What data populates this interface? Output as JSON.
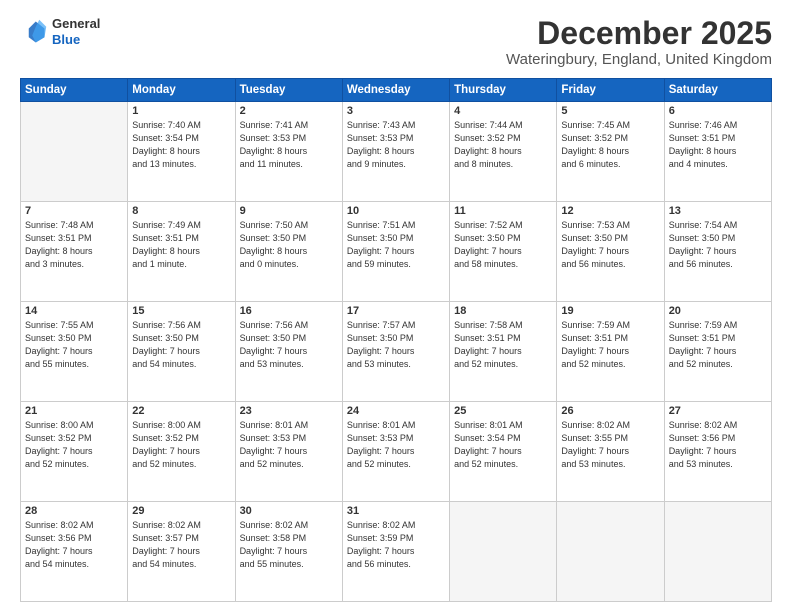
{
  "header": {
    "logo_line1": "General",
    "logo_line2": "Blue",
    "title": "December 2025",
    "subtitle": "Wateringbury, England, United Kingdom"
  },
  "days_of_week": [
    "Sunday",
    "Monday",
    "Tuesday",
    "Wednesday",
    "Thursday",
    "Friday",
    "Saturday"
  ],
  "weeks": [
    [
      {
        "day": "",
        "info": ""
      },
      {
        "day": "1",
        "info": "Sunrise: 7:40 AM\nSunset: 3:54 PM\nDaylight: 8 hours\nand 13 minutes."
      },
      {
        "day": "2",
        "info": "Sunrise: 7:41 AM\nSunset: 3:53 PM\nDaylight: 8 hours\nand 11 minutes."
      },
      {
        "day": "3",
        "info": "Sunrise: 7:43 AM\nSunset: 3:53 PM\nDaylight: 8 hours\nand 9 minutes."
      },
      {
        "day": "4",
        "info": "Sunrise: 7:44 AM\nSunset: 3:52 PM\nDaylight: 8 hours\nand 8 minutes."
      },
      {
        "day": "5",
        "info": "Sunrise: 7:45 AM\nSunset: 3:52 PM\nDaylight: 8 hours\nand 6 minutes."
      },
      {
        "day": "6",
        "info": "Sunrise: 7:46 AM\nSunset: 3:51 PM\nDaylight: 8 hours\nand 4 minutes."
      }
    ],
    [
      {
        "day": "7",
        "info": "Sunrise: 7:48 AM\nSunset: 3:51 PM\nDaylight: 8 hours\nand 3 minutes."
      },
      {
        "day": "8",
        "info": "Sunrise: 7:49 AM\nSunset: 3:51 PM\nDaylight: 8 hours\nand 1 minute."
      },
      {
        "day": "9",
        "info": "Sunrise: 7:50 AM\nSunset: 3:50 PM\nDaylight: 8 hours\nand 0 minutes."
      },
      {
        "day": "10",
        "info": "Sunrise: 7:51 AM\nSunset: 3:50 PM\nDaylight: 7 hours\nand 59 minutes."
      },
      {
        "day": "11",
        "info": "Sunrise: 7:52 AM\nSunset: 3:50 PM\nDaylight: 7 hours\nand 58 minutes."
      },
      {
        "day": "12",
        "info": "Sunrise: 7:53 AM\nSunset: 3:50 PM\nDaylight: 7 hours\nand 56 minutes."
      },
      {
        "day": "13",
        "info": "Sunrise: 7:54 AM\nSunset: 3:50 PM\nDaylight: 7 hours\nand 56 minutes."
      }
    ],
    [
      {
        "day": "14",
        "info": "Sunrise: 7:55 AM\nSunset: 3:50 PM\nDaylight: 7 hours\nand 55 minutes."
      },
      {
        "day": "15",
        "info": "Sunrise: 7:56 AM\nSunset: 3:50 PM\nDaylight: 7 hours\nand 54 minutes."
      },
      {
        "day": "16",
        "info": "Sunrise: 7:56 AM\nSunset: 3:50 PM\nDaylight: 7 hours\nand 53 minutes."
      },
      {
        "day": "17",
        "info": "Sunrise: 7:57 AM\nSunset: 3:50 PM\nDaylight: 7 hours\nand 53 minutes."
      },
      {
        "day": "18",
        "info": "Sunrise: 7:58 AM\nSunset: 3:51 PM\nDaylight: 7 hours\nand 52 minutes."
      },
      {
        "day": "19",
        "info": "Sunrise: 7:59 AM\nSunset: 3:51 PM\nDaylight: 7 hours\nand 52 minutes."
      },
      {
        "day": "20",
        "info": "Sunrise: 7:59 AM\nSunset: 3:51 PM\nDaylight: 7 hours\nand 52 minutes."
      }
    ],
    [
      {
        "day": "21",
        "info": "Sunrise: 8:00 AM\nSunset: 3:52 PM\nDaylight: 7 hours\nand 52 minutes."
      },
      {
        "day": "22",
        "info": "Sunrise: 8:00 AM\nSunset: 3:52 PM\nDaylight: 7 hours\nand 52 minutes."
      },
      {
        "day": "23",
        "info": "Sunrise: 8:01 AM\nSunset: 3:53 PM\nDaylight: 7 hours\nand 52 minutes."
      },
      {
        "day": "24",
        "info": "Sunrise: 8:01 AM\nSunset: 3:53 PM\nDaylight: 7 hours\nand 52 minutes."
      },
      {
        "day": "25",
        "info": "Sunrise: 8:01 AM\nSunset: 3:54 PM\nDaylight: 7 hours\nand 52 minutes."
      },
      {
        "day": "26",
        "info": "Sunrise: 8:02 AM\nSunset: 3:55 PM\nDaylight: 7 hours\nand 53 minutes."
      },
      {
        "day": "27",
        "info": "Sunrise: 8:02 AM\nSunset: 3:56 PM\nDaylight: 7 hours\nand 53 minutes."
      }
    ],
    [
      {
        "day": "28",
        "info": "Sunrise: 8:02 AM\nSunset: 3:56 PM\nDaylight: 7 hours\nand 54 minutes."
      },
      {
        "day": "29",
        "info": "Sunrise: 8:02 AM\nSunset: 3:57 PM\nDaylight: 7 hours\nand 54 minutes."
      },
      {
        "day": "30",
        "info": "Sunrise: 8:02 AM\nSunset: 3:58 PM\nDaylight: 7 hours\nand 55 minutes."
      },
      {
        "day": "31",
        "info": "Sunrise: 8:02 AM\nSunset: 3:59 PM\nDaylight: 7 hours\nand 56 minutes."
      },
      {
        "day": "",
        "info": ""
      },
      {
        "day": "",
        "info": ""
      },
      {
        "day": "",
        "info": ""
      }
    ]
  ]
}
